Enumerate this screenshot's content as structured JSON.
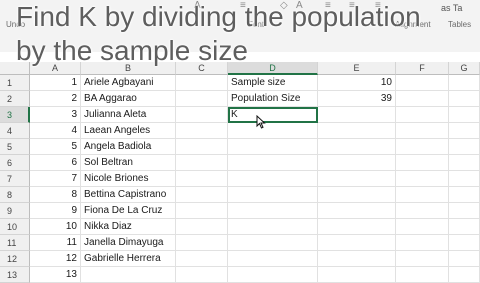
{
  "title": {
    "line1": "Find K by dividing the population",
    "line2": "by the sample size"
  },
  "ribbon": {
    "groups": {
      "undo": "Undo",
      "font": "Font",
      "alignment": "Alignment",
      "format": "as Ta",
      "tables": "Tables"
    }
  },
  "columns": [
    "A",
    "B",
    "C",
    "D",
    "E",
    "F",
    "G"
  ],
  "active_cell": "D3",
  "rows": [
    {
      "num": "1",
      "A": "1",
      "B": "Ariele Agbayani",
      "D": "Sample size",
      "E": "10"
    },
    {
      "num": "2",
      "A": "2",
      "B": "BA Aggarao",
      "D": "Population Size",
      "E": "39"
    },
    {
      "num": "3",
      "A": "3",
      "B": "Julianna Aleta",
      "D": "K",
      "E": ""
    },
    {
      "num": "4",
      "A": "4",
      "B": "Laean Angeles",
      "D": "",
      "E": ""
    },
    {
      "num": "5",
      "A": "5",
      "B": "Angela Badiola",
      "D": "",
      "E": ""
    },
    {
      "num": "6",
      "A": "6",
      "B": "Sol Beltran",
      "D": "",
      "E": ""
    },
    {
      "num": "7",
      "A": "7",
      "B": "Nicole Briones",
      "D": "",
      "E": ""
    },
    {
      "num": "8",
      "A": "8",
      "B": "Bettina Capistrano",
      "D": "",
      "E": ""
    },
    {
      "num": "9",
      "A": "9",
      "B": "Fiona De La Cruz",
      "D": "",
      "E": ""
    },
    {
      "num": "10",
      "A": "10",
      "B": "Nikka Diaz",
      "D": "",
      "E": ""
    },
    {
      "num": "11",
      "A": "11",
      "B": "Janella Dimayuga",
      "D": "",
      "E": ""
    },
    {
      "num": "12",
      "A": "12",
      "B": "Gabrielle Herrera",
      "D": "",
      "E": ""
    },
    {
      "num": "13",
      "A": "13",
      "B": "",
      "D": "",
      "E": ""
    }
  ],
  "icons": {
    "cursor": "text-select-cursor-icon"
  }
}
